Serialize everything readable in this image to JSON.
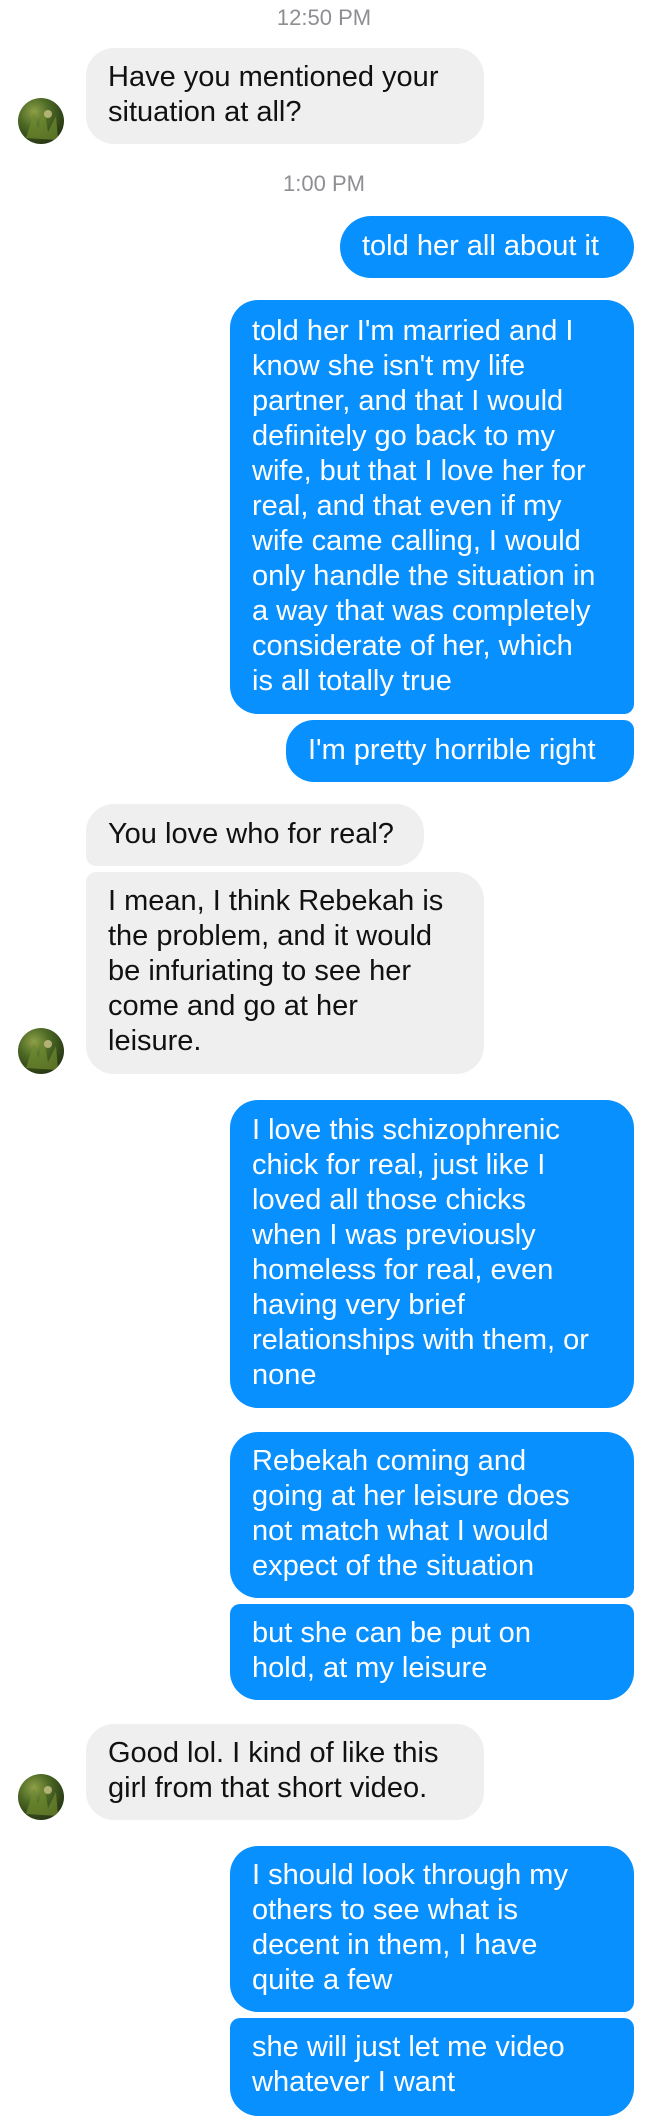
{
  "timestamps": [
    "12:50 PM",
    "1:00 PM"
  ],
  "messages": {
    "m1": {
      "lines": [
        "Have you mentioned your",
        "situation at all?"
      ]
    },
    "m2": {
      "lines": [
        "told her all about it"
      ]
    },
    "m3": {
      "lines": [
        "told her I'm married and I",
        "know she isn't my life",
        "partner, and that I would",
        "definitely go back to my",
        "wife, but that I love her for",
        "real, and that even if my",
        "wife came calling, I would",
        "only handle the situation in",
        "a way that was completely",
        "considerate of her, which",
        "is all totally true"
      ]
    },
    "m4": {
      "lines": [
        "I'm pretty horrible right"
      ]
    },
    "m5": {
      "lines": [
        "You love who for real?"
      ]
    },
    "m6": {
      "lines": [
        "I mean, I think Rebekah is",
        "the problem, and it would",
        "be infuriating to see her",
        "come and go at her",
        "leisure."
      ]
    },
    "m7": {
      "lines": [
        "I love this schizophrenic",
        "chick for real, just like I",
        "loved all those chicks",
        "when I was previously",
        "homeless for real, even",
        "having very brief",
        "relationships with them, or",
        "none"
      ]
    },
    "m8": {
      "lines": [
        "Rebekah coming and",
        "going at her leisure does",
        "not match what I would",
        "expect of the situation"
      ]
    },
    "m9": {
      "lines": [
        "but she can be put on",
        "hold, at my leisure"
      ]
    },
    "m10": {
      "lines": [
        "Good lol. I kind of like this",
        "girl from that short video."
      ]
    },
    "m11": {
      "lines": [
        "I should look through my",
        "others to see what is",
        "decent in them, I have",
        "quite a few"
      ]
    },
    "m12": {
      "lines": [
        "she will just let me video",
        "whatever I want"
      ]
    }
  },
  "colors": {
    "outgoing_bubble": "#0990ff",
    "incoming_bubble": "#efefef",
    "timestamp": "#8e8e93"
  },
  "icons": {
    "avatar": "contact-avatar-photo"
  }
}
